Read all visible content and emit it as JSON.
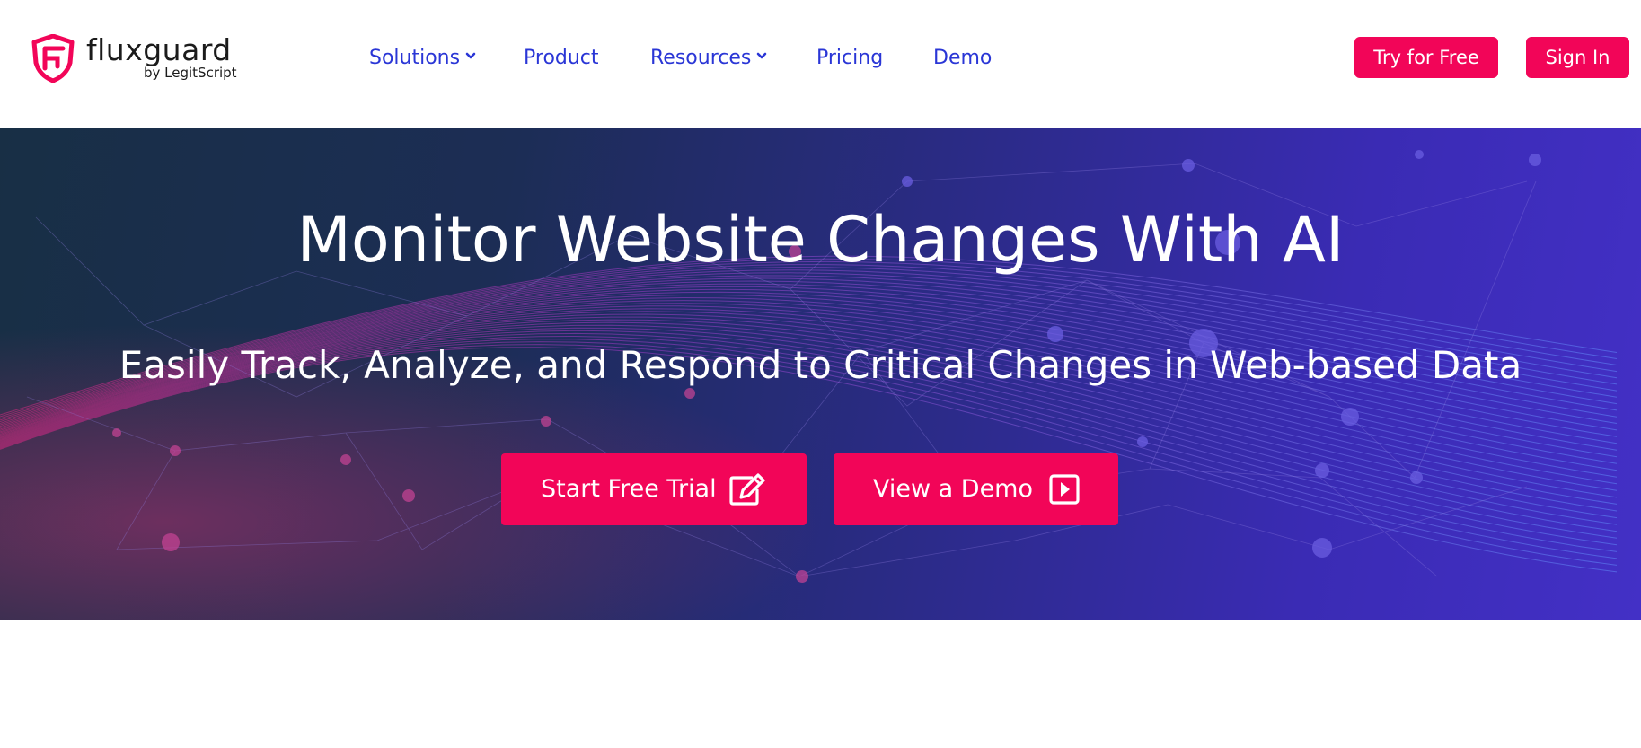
{
  "brand": {
    "name": "fluxguard",
    "byline": "by LegitScript",
    "accent_color": "#f20558",
    "nav_color": "#2a36d6"
  },
  "nav": {
    "items": [
      {
        "label": "Solutions",
        "has_dropdown": true
      },
      {
        "label": "Product",
        "has_dropdown": false
      },
      {
        "label": "Resources",
        "has_dropdown": true
      },
      {
        "label": "Pricing",
        "has_dropdown": false
      },
      {
        "label": "Demo",
        "has_dropdown": false
      }
    ]
  },
  "header_actions": {
    "try_label": "Try for Free",
    "signin_label": "Sign In"
  },
  "hero": {
    "title": "Monitor Website Changes With AI",
    "subtitle": "Easily Track, Analyze, and Respond to Critical Changes in Web-based Data",
    "primary_cta": {
      "label": "Start Free Trial",
      "icon": "edit-icon"
    },
    "secondary_cta": {
      "label": "View a Demo",
      "icon": "play-icon"
    }
  }
}
